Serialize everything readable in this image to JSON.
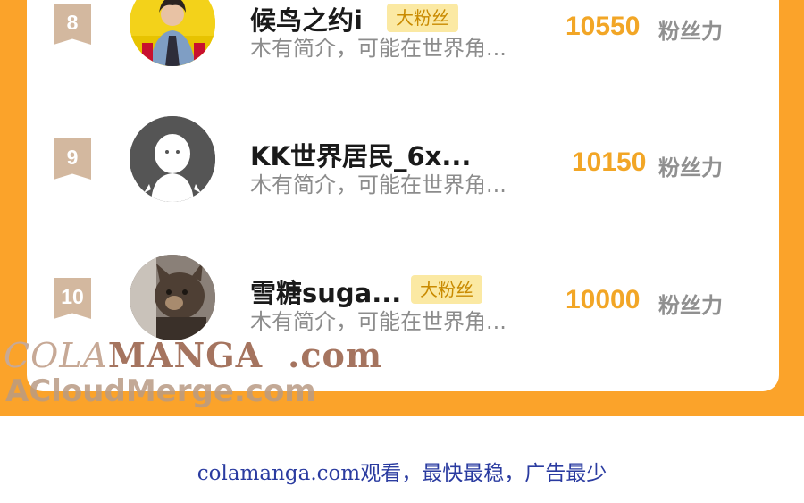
{
  "ranking": {
    "items": [
      {
        "rank": "8",
        "name": "候鸟之约i",
        "tag": "大粉丝",
        "bio": "木有简介，可能在世界角...",
        "score": "10550",
        "unit": "粉丝力"
      },
      {
        "rank": "9",
        "name": "KK世界居民_6x...",
        "tag": "",
        "bio": "木有简介，可能在世界角...",
        "score": "10150",
        "unit": "粉丝力"
      },
      {
        "rank": "10",
        "name": "雪糖suga...",
        "tag": "大粉丝",
        "bio": "木有简介，可能在世界角...",
        "score": "10000",
        "unit": "粉丝力"
      }
    ]
  },
  "watermark": {
    "line1_part1": "COLA",
    "line1_part2": "MANGA",
    "line1_part3": ".com",
    "line2": "ACloudMerge.com"
  },
  "footer": {
    "text": "colamanga.com观看，最快最稳，广告最少"
  },
  "colors": {
    "orange": "#fba32a",
    "score": "#f2a626",
    "badge": "#d3b89f",
    "tag_bg": "#fbe9a3"
  }
}
